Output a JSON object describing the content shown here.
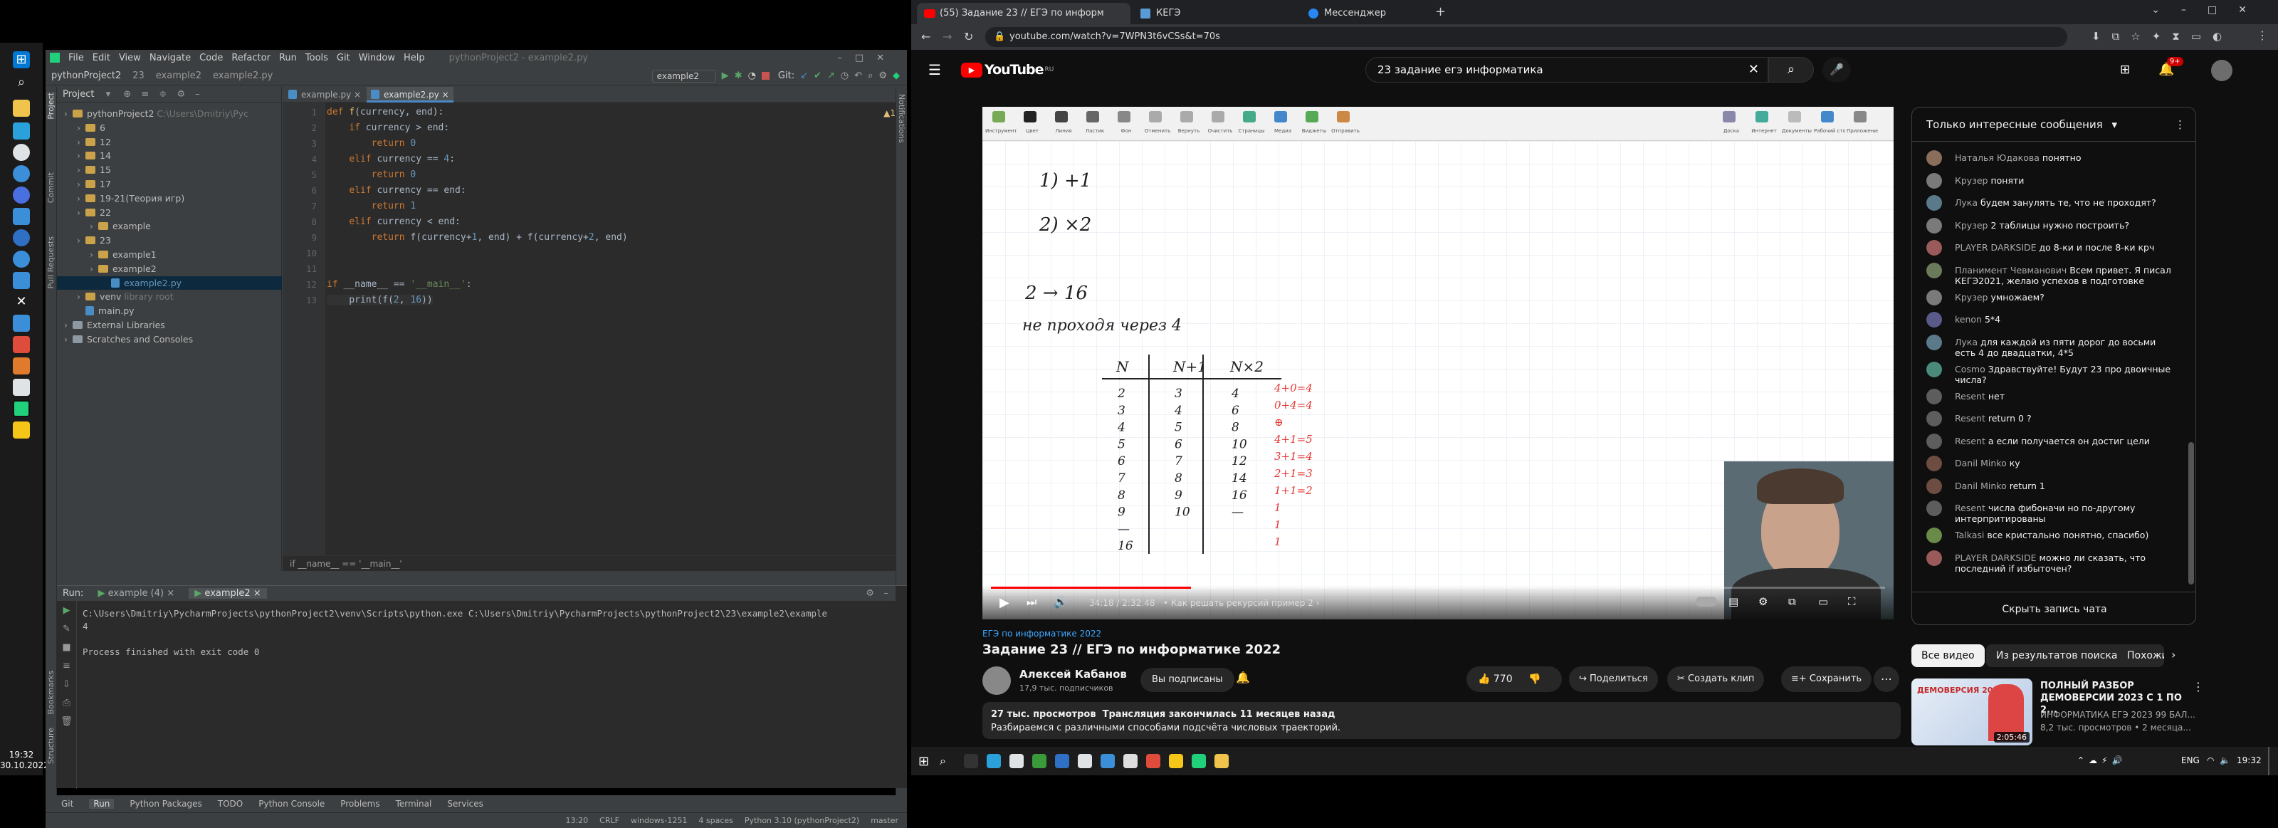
{
  "left_taskbar": {
    "clock_time": "19:32",
    "clock_date": "30.10.2022"
  },
  "ide": {
    "menu": [
      "File",
      "Edit",
      "View",
      "Navigate",
      "Code",
      "Refactor",
      "Run",
      "Tools",
      "Git",
      "Window",
      "Help"
    ],
    "title": "pythonProject2 - example2.py",
    "nav": {
      "crumbs": [
        "pythonProject2",
        "23",
        "example2",
        "example2.py"
      ],
      "run_config": "example2",
      "git_label": "Git:"
    },
    "project_panel": {
      "header": "Project",
      "items": [
        {
          "label": "pythonProject2",
          "hint": "C:\\Users\\Dmitriy\\Pyc",
          "kind": "folder",
          "depth": 0
        },
        {
          "label": "6",
          "kind": "folder",
          "depth": 1
        },
        {
          "label": "12",
          "kind": "folder",
          "depth": 1
        },
        {
          "label": "14",
          "kind": "folder",
          "depth": 1
        },
        {
          "label": "15",
          "kind": "folder",
          "depth": 1
        },
        {
          "label": "17",
          "kind": "folder",
          "depth": 1
        },
        {
          "label": "19-21(Теория игр)",
          "kind": "folder",
          "depth": 1
        },
        {
          "label": "22",
          "kind": "folder",
          "depth": 1
        },
        {
          "label": "example",
          "kind": "folder",
          "depth": 2
        },
        {
          "label": "23",
          "kind": "folder",
          "depth": 1
        },
        {
          "label": "example1",
          "kind": "folder",
          "depth": 2
        },
        {
          "label": "example2",
          "kind": "folder",
          "depth": 2
        },
        {
          "label": "example2.py",
          "kind": "py",
          "depth": 3,
          "selected": true
        },
        {
          "label": "venv",
          "hint": "library root",
          "kind": "folder",
          "depth": 1
        },
        {
          "label": "main.py",
          "kind": "py",
          "depth": 1
        },
        {
          "label": "External Libraries",
          "kind": "lib",
          "depth": 0
        },
        {
          "label": "Scratches and Consoles",
          "kind": "lib",
          "depth": 0
        }
      ],
      "side_tabs": [
        "Project",
        "Commit",
        "Pull Requests"
      ]
    },
    "editor_tabs": [
      "example.py",
      "example2.py"
    ],
    "inspection_badge": "▲1",
    "code_lines": [
      [
        {
          "t": "def ",
          "c": "kw"
        },
        {
          "t": "f",
          "c": "fn"
        },
        {
          "t": "(currency, end):",
          "c": "tx"
        }
      ],
      [
        {
          "t": "    ",
          "c": "tx"
        },
        {
          "t": "if ",
          "c": "kw"
        },
        {
          "t": "currency > end:",
          "c": "tx"
        }
      ],
      [
        {
          "t": "        ",
          "c": "tx"
        },
        {
          "t": "return ",
          "c": "kw"
        },
        {
          "t": "0",
          "c": "num"
        }
      ],
      [
        {
          "t": "    ",
          "c": "tx"
        },
        {
          "t": "elif ",
          "c": "kw"
        },
        {
          "t": "currency == ",
          "c": "tx"
        },
        {
          "t": "4",
          "c": "num"
        },
        {
          "t": ":",
          "c": "tx"
        }
      ],
      [
        {
          "t": "        ",
          "c": "tx"
        },
        {
          "t": "return ",
          "c": "kw"
        },
        {
          "t": "0",
          "c": "num"
        }
      ],
      [
        {
          "t": "    ",
          "c": "tx"
        },
        {
          "t": "elif ",
          "c": "kw"
        },
        {
          "t": "currency == end:",
          "c": "tx"
        }
      ],
      [
        {
          "t": "        ",
          "c": "tx"
        },
        {
          "t": "return ",
          "c": "kw"
        },
        {
          "t": "1",
          "c": "num"
        }
      ],
      [
        {
          "t": "    ",
          "c": "tx"
        },
        {
          "t": "elif ",
          "c": "kw"
        },
        {
          "t": "currency < end:",
          "c": "tx"
        }
      ],
      [
        {
          "t": "        ",
          "c": "tx"
        },
        {
          "t": "return ",
          "c": "kw"
        },
        {
          "t": "f(currency+",
          "c": "tx"
        },
        {
          "t": "1",
          "c": "num"
        },
        {
          "t": ", end) + f(currency+",
          "c": "tx"
        },
        {
          "t": "2",
          "c": "num"
        },
        {
          "t": ", end)",
          "c": "tx"
        }
      ],
      [],
      [],
      [
        {
          "t": "if ",
          "c": "kw"
        },
        {
          "t": "__name__ == ",
          "c": "tx"
        },
        {
          "t": "'__main__'",
          "c": "str"
        },
        {
          "t": ":",
          "c": "tx"
        }
      ],
      [
        {
          "t": "    print(f(",
          "c": "tx"
        },
        {
          "t": "2",
          "c": "num"
        },
        {
          "t": ", ",
          "c": "tx"
        },
        {
          "t": "16",
          "c": "num"
        },
        {
          "t": "))",
          "c": "tx"
        }
      ]
    ],
    "breadcrumb_bottom": "if __name__ == '__main__'",
    "run": {
      "label": "Run:",
      "tabs": [
        "example (4)",
        "example2"
      ],
      "output": [
        "C:\\Users\\Dmitriy\\PycharmProjects\\pythonProject2\\venv\\Scripts\\python.exe C:\\Users\\Dmitriy\\PycharmProjects\\pythonProject2\\23\\example2\\example",
        "4",
        "",
        "Process finished with exit code 0"
      ]
    },
    "bottom_tabs": [
      "Git",
      "Run",
      "Python Packages",
      "TODO",
      "Python Console",
      "Problems",
      "Terminal",
      "Services"
    ],
    "status": [
      "13:20",
      "CRLF",
      "windows-1251",
      "4 spaces",
      "Python 3.10 (pythonProject2)",
      "master"
    ],
    "right_side_tab": "Notifications",
    "left_side_tabs": [
      "Bookmarks",
      "Structure"
    ]
  },
  "browser": {
    "tabs": [
      "(55) Задание 23 // ЕГЭ по информ",
      "КЕГЭ",
      "Мессенджер"
    ],
    "url": "youtube.com/watch?v=7WPN3t6vCSs&t=70s"
  },
  "youtube": {
    "logo": "YouTube",
    "logo_sup": "RU",
    "search": "23 задание егэ информатика",
    "notif_count": "9+",
    "video": {
      "whiteboard_labels": [
        "Инструменты",
        "Цвет",
        "Линия",
        "Ластик",
        "Фон",
        "Отменить",
        "Вернуть",
        "Очистить",
        "Страницы",
        "Медиа",
        "Виджеты",
        "Отправить",
        "Доска",
        "Интернет",
        "Документы",
        "Рабочий стол",
        "Приложения"
      ],
      "hand_lines": [
        "1) +1",
        "2) ×2",
        "2 → 16",
        "не проходя через 4"
      ],
      "table_headers": [
        "N",
        "N+1",
        "N×2"
      ],
      "table_rows": [
        [
          "2",
          "3",
          "4"
        ],
        [
          "3",
          "4",
          "6"
        ],
        [
          "4",
          "5",
          "8"
        ],
        [
          "5",
          "6",
          "10"
        ],
        [
          "6",
          "7",
          "12"
        ],
        [
          "7",
          "8",
          "14"
        ],
        [
          "8",
          "9",
          "16"
        ],
        [
          "9",
          "10",
          "—"
        ],
        [
          "—",
          "",
          ""
        ],
        [
          "16",
          "",
          ""
        ]
      ],
      "red_notes": [
        "4+0=4",
        "0+4=4",
        "⊕",
        "4+1=5",
        "3+1=4",
        "2+1=3",
        "1+1=2",
        "1",
        "1",
        "1"
      ],
      "time": "34:18 / 2:32:48",
      "chapter": "• Как решать рекурсий пример 2 ›",
      "progress": 0.224
    },
    "channel_tag": "ЕГЭ по информатике 2022",
    "title": "Задание 23 // ЕГЭ по информатике 2022",
    "channel": "Алексей Кабанов",
    "subs": "17,9 тыс. подписчиков",
    "subscribed": "Вы подписаны",
    "likes": "770",
    "share": "Поделиться",
    "clip": "Создать клип",
    "save": "Сохранить",
    "views": "27 тыс. просмотров",
    "stream": "Трансляция закончилась 11 месяцев назад",
    "desc": "Разбираемся с различными способами подсчёта числовых траекторий.",
    "chat": {
      "header": "Только интересные сообщения",
      "hide": "Скрыть запись чата",
      "messages": [
        {
          "a": "Наталья Юдакова",
          "m": "понятно"
        },
        {
          "a": "Крузер",
          "m": "поняти"
        },
        {
          "a": "Лука",
          "m": "будем занулять те, что не проходят?"
        },
        {
          "a": "Крузер",
          "m": "2 таблицы нужно построить?"
        },
        {
          "a": "PLAYER DARKSIDE",
          "m": "до 8-ки и после 8-ки крч"
        },
        {
          "a": "Планимент Чевманович",
          "m": "Всем привет. Я писал КЕГЭ2021, желаю успехов в подготовке"
        },
        {
          "a": "Крузер",
          "m": "умножаем?"
        },
        {
          "a": "kenon",
          "m": "5*4"
        },
        {
          "a": "Лука",
          "m": "для каждой из пяти дорог до восьми есть 4 до двадцатки, 4*5"
        },
        {
          "a": "Cosmo",
          "m": "Здравствуйте! Будут 23 про двоичные числа?"
        },
        {
          "a": "Resent",
          "m": "нет"
        },
        {
          "a": "Resent",
          "m": "return 0 ?"
        },
        {
          "a": "Resent",
          "m": "а если получается он достиг цели"
        },
        {
          "a": "Danil Minko",
          "m": "ку"
        },
        {
          "a": "Danil Minko",
          "m": "return 1"
        },
        {
          "a": "Resent",
          "m": "числа фибоначи но по-другому интерпритированы"
        },
        {
          "a": "Talkasi",
          "m": "все кристально понятно, спасибо)"
        },
        {
          "a": "PLAYER DARKSIDE",
          "m": "можно ли сказать, что последний if избыточен?"
        }
      ]
    },
    "chips": [
      "Все видео",
      "Из результатов поиска",
      "Похожие"
    ],
    "rec": {
      "title": "ПОЛНЫЙ РАЗБОР ДЕМОВЕРСИИ 2023 С 1 ПО 2...",
      "channel": "ИНФОРМАТИКА ЕГЭ 2023 99 БАЛ...",
      "meta": "8,2 тыс. просмотров • 2 месяца...",
      "thumb_text": "ДЕМОВЕРСИЯ 2023",
      "duration": "2:05:46"
    }
  },
  "right_taskbar": {
    "lang": "ENG",
    "time": "19:32"
  }
}
